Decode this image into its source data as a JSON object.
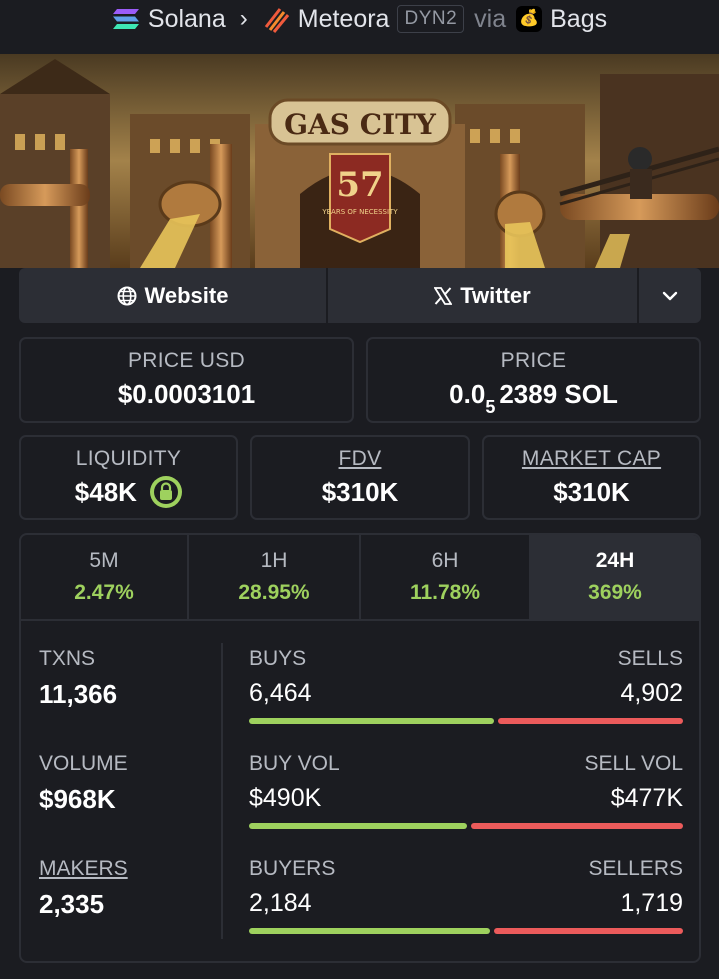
{
  "breadcrumb": {
    "chain": "Solana",
    "dex": "Meteora",
    "pool_badge": "DYN2",
    "via": "via",
    "launchpad": "Bags"
  },
  "banner": {
    "sign_text": "GAS CITY",
    "flag_number": "57",
    "flag_sub": "YEARS OF NECESSITY"
  },
  "links": {
    "website": "Website",
    "twitter": "Twitter"
  },
  "price_usd": {
    "label": "PRICE USD",
    "value": "$0.0003101"
  },
  "price_native": {
    "label": "PRICE",
    "prefix": "0.0",
    "zeros": "5",
    "suffix": "2389 SOL"
  },
  "liquidity": {
    "label": "LIQUIDITY",
    "value": "$48K"
  },
  "fdv": {
    "label": "FDV",
    "value": "$310K"
  },
  "market_cap": {
    "label": "MARKET CAP",
    "value": "$310K"
  },
  "periods": [
    {
      "label": "5M",
      "change": "2.47%"
    },
    {
      "label": "1H",
      "change": "28.95%"
    },
    {
      "label": "6H",
      "change": "11.78%"
    },
    {
      "label": "24H",
      "change": "369%",
      "active": true
    }
  ],
  "txns": {
    "label": "TXNS",
    "value": "11,366"
  },
  "volume": {
    "label": "VOLUME",
    "value": "$968K"
  },
  "makers": {
    "label": "MAKERS",
    "value": "2,335"
  },
  "buys_sells": {
    "left_label": "BUYS",
    "right_label": "SELLS",
    "left_value": "6,464",
    "right_value": "4,902",
    "buy_fraction": 0.5687
  },
  "vol_split": {
    "left_label": "BUY VOL",
    "right_label": "SELL VOL",
    "left_value": "$490K",
    "right_value": "$477K",
    "buy_fraction": 0.5067
  },
  "buyers_sellers": {
    "left_label": "BUYERS",
    "right_label": "SELLERS",
    "left_value": "2,184",
    "right_value": "1,719",
    "buy_fraction": 0.5596
  },
  "colors": {
    "positive": "#9ed15e",
    "negative": "#ec5b5b",
    "background": "#1b1c21",
    "panel": "#2c2e35"
  }
}
